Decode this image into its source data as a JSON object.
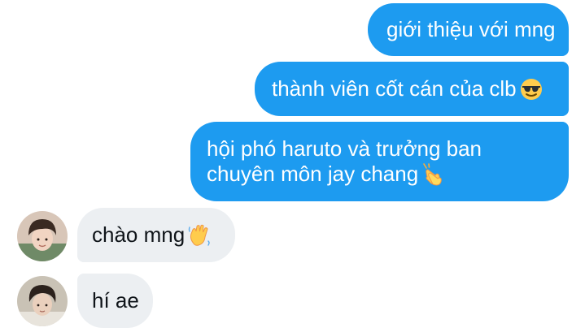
{
  "conversation": {
    "sent_messages": [
      {
        "text": "giới thiệu với mng"
      },
      {
        "text": "thành viên cốt cán của clb",
        "emoji": "sunglasses-emoji"
      },
      {
        "line1": "hội phó haruto và trưởng ban",
        "line2": "chuyên môn jay chang",
        "emoji": "clapping-hands-emoji"
      }
    ],
    "received_messages": [
      {
        "text": "chào mng",
        "emoji": "waving-hand-emoji",
        "sender_avatar": "avatar-haruto"
      },
      {
        "text": "hí ae",
        "sender_avatar": "avatar-jay-chang"
      }
    ]
  },
  "colors": {
    "sent_bubble": "#1d9bf0",
    "received_bubble": "#eceff2",
    "sent_text": "#ffffff",
    "received_text": "#0f1419"
  }
}
